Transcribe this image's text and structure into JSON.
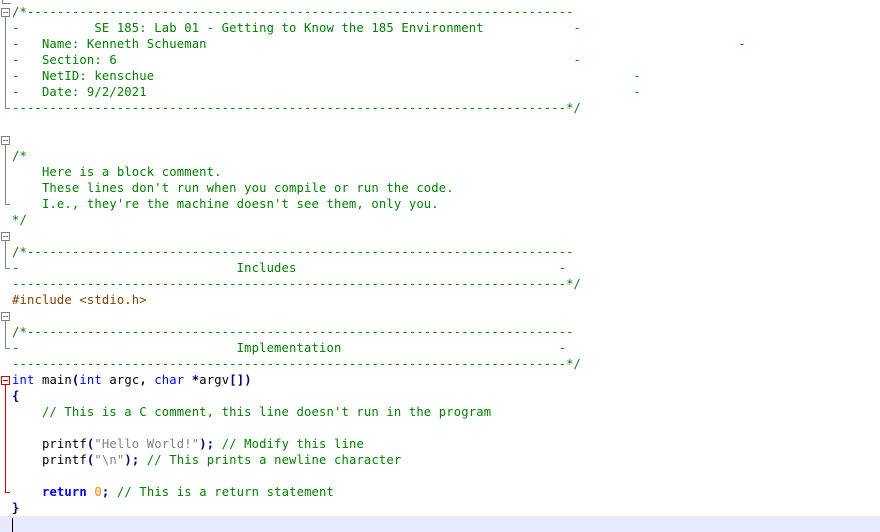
{
  "editor": {
    "lines": [
      [
        {
          "text": "/*-------------------------------------------------------------------------",
          "cls": "c-com"
        }
      ],
      [
        {
          "text": "-          SE 185: Lab 01 - Getting to Know the 185 Environment            -",
          "cls": "c-com"
        }
      ],
      [
        {
          "text": "-   Name: Kenneth Schueman                                                                       -",
          "cls": "c-com"
        }
      ],
      [
        {
          "text": "-   Section: 6                                                             -",
          "cls": "c-com"
        }
      ],
      [
        {
          "text": "-   NetID: kenschue                                                                -",
          "cls": "c-com"
        }
      ],
      [
        {
          "text": "-   Date: 9/2/2021                                                                 -",
          "cls": "c-com"
        }
      ],
      [
        {
          "text": "--------------------------------------------------------------------------*/",
          "cls": "c-com"
        }
      ],
      [],
      [],
      [
        {
          "text": "/*",
          "cls": "c-com"
        }
      ],
      [
        {
          "text": "    Here is a block comment.",
          "cls": "c-com"
        }
      ],
      [
        {
          "text": "    These lines don't run when you compile or run the code.",
          "cls": "c-com"
        }
      ],
      [
        {
          "text": "    I.e., they're the machine doesn't see them, only you.",
          "cls": "c-com"
        }
      ],
      [
        {
          "text": "*/",
          "cls": "c-com"
        }
      ],
      [],
      [
        {
          "text": "/*-------------------------------------------------------------------------",
          "cls": "c-com"
        }
      ],
      [
        {
          "text": "-                             Includes                                   -",
          "cls": "c-com"
        }
      ],
      [
        {
          "text": "--------------------------------------------------------------------------*/",
          "cls": "c-com"
        }
      ],
      [
        {
          "text": "#include <stdio.h>",
          "cls": "c-pp"
        }
      ],
      [],
      [
        {
          "text": "/*-------------------------------------------------------------------------",
          "cls": "c-com"
        }
      ],
      [
        {
          "text": "-                             Implementation                             -",
          "cls": "c-com"
        }
      ],
      [
        {
          "text": "--------------------------------------------------------------------------*/",
          "cls": "c-com"
        }
      ],
      [
        {
          "text": "int",
          "cls": "c-kw"
        },
        {
          "text": " main",
          "cls": "c-txt"
        },
        {
          "text": "(",
          "cls": "c-op"
        },
        {
          "text": "int",
          "cls": "c-kw"
        },
        {
          "text": " argc",
          "cls": "c-txt"
        },
        {
          "text": ",",
          "cls": "c-op"
        },
        {
          "text": " ",
          "cls": "c-txt"
        },
        {
          "text": "char",
          "cls": "c-kw"
        },
        {
          "text": " ",
          "cls": "c-txt"
        },
        {
          "text": "*",
          "cls": "c-op"
        },
        {
          "text": "argv",
          "cls": "c-txt"
        },
        {
          "text": "[])",
          "cls": "c-op"
        }
      ],
      [
        {
          "text": "{",
          "cls": "c-op"
        }
      ],
      [
        {
          "text": "    // This is a C comment, this line doesn't run in the program",
          "cls": "c-com"
        }
      ],
      [],
      [
        {
          "text": "    printf",
          "cls": "c-txt"
        },
        {
          "text": "(",
          "cls": "c-op"
        },
        {
          "text": "\"Hello World!\"",
          "cls": "c-str"
        },
        {
          "text": ");",
          "cls": "c-op"
        },
        {
          "text": " // Modify this line",
          "cls": "c-com"
        }
      ],
      [
        {
          "text": "    printf",
          "cls": "c-txt"
        },
        {
          "text": "(",
          "cls": "c-op"
        },
        {
          "text": "\"\\n\"",
          "cls": "c-str"
        },
        {
          "text": ");",
          "cls": "c-op"
        },
        {
          "text": " // This prints a newline character",
          "cls": "c-com"
        }
      ],
      [],
      [
        {
          "text": "    ",
          "cls": "c-txt"
        },
        {
          "text": "return",
          "cls": "c-kwb"
        },
        {
          "text": " ",
          "cls": "c-txt"
        },
        {
          "text": "0",
          "cls": "c-num"
        },
        {
          "text": ";",
          "cls": "c-op"
        },
        {
          "text": " // This is a return statement",
          "cls": "c-com"
        }
      ],
      [
        {
          "text": "}",
          "cls": "c-op"
        }
      ],
      []
    ],
    "current_line": 32
  }
}
